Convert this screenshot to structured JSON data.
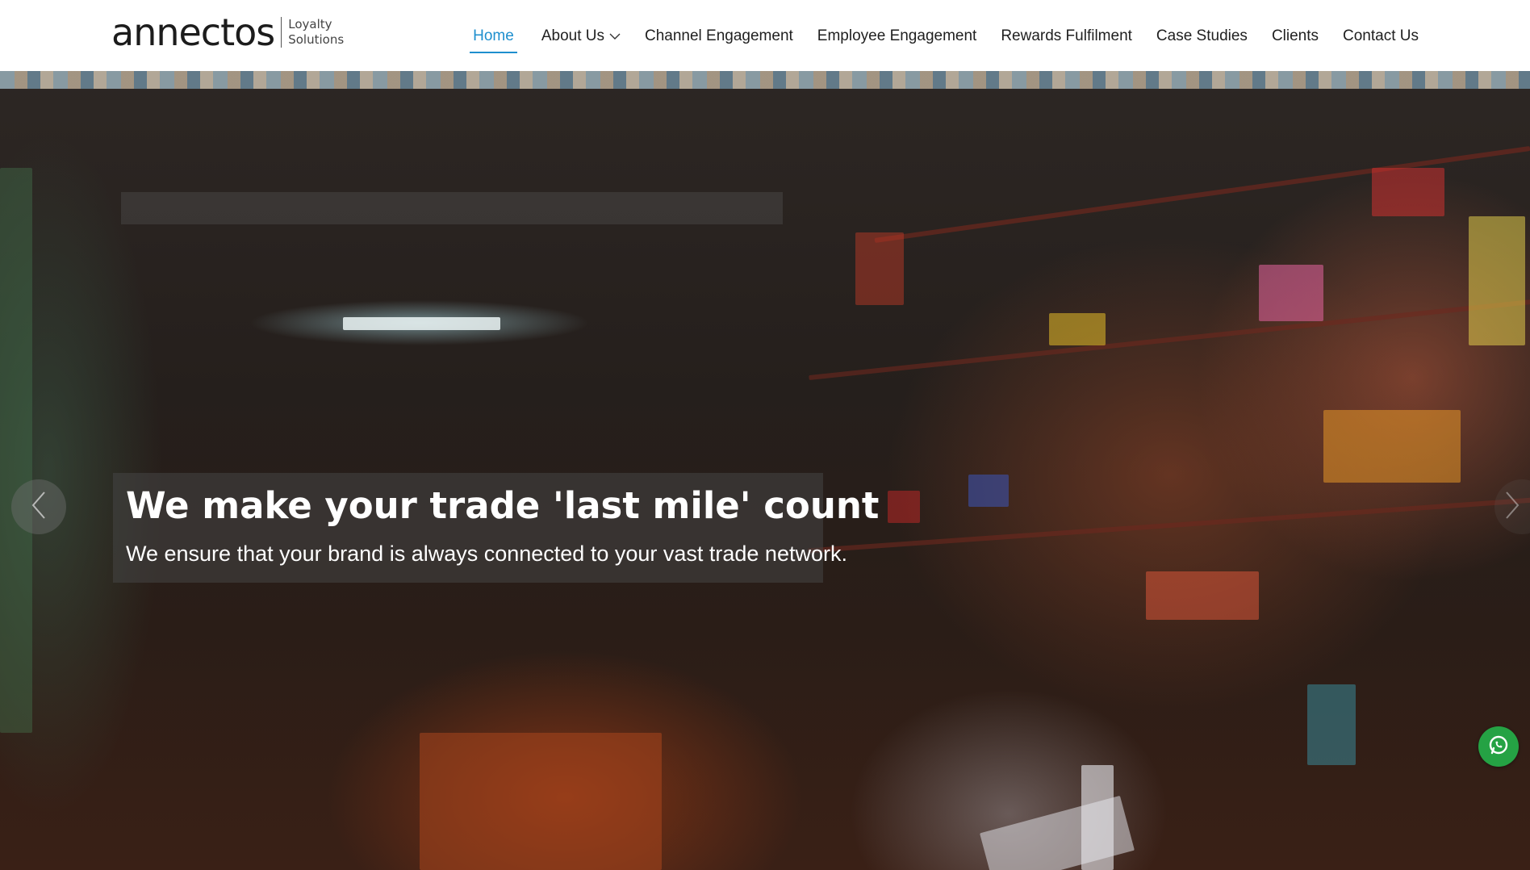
{
  "brand": {
    "name": "annectos",
    "tagline_line1": "Loyalty",
    "tagline_line2": "Solutions"
  },
  "nav": {
    "items": [
      {
        "label": "Home",
        "active": true
      },
      {
        "label": "About Us",
        "has_dropdown": true
      },
      {
        "label": "Channel Engagement"
      },
      {
        "label": "Employee Engagement"
      },
      {
        "label": "Rewards Fulfilment"
      },
      {
        "label": "Case Studies"
      },
      {
        "label": "Clients"
      },
      {
        "label": "Contact Us"
      }
    ]
  },
  "hero": {
    "title": "We make your trade 'last mile' count",
    "subtitle": "We ensure that your brand is always connected to your vast trade network.",
    "prev_icon": "chevron-left-icon",
    "next_icon": "chevron-right-icon"
  },
  "floating": {
    "whatsapp_icon": "whatsapp-icon"
  },
  "colors": {
    "accent": "#1e8fce",
    "whatsapp": "#25a244",
    "header_bg": "#ffffff"
  }
}
